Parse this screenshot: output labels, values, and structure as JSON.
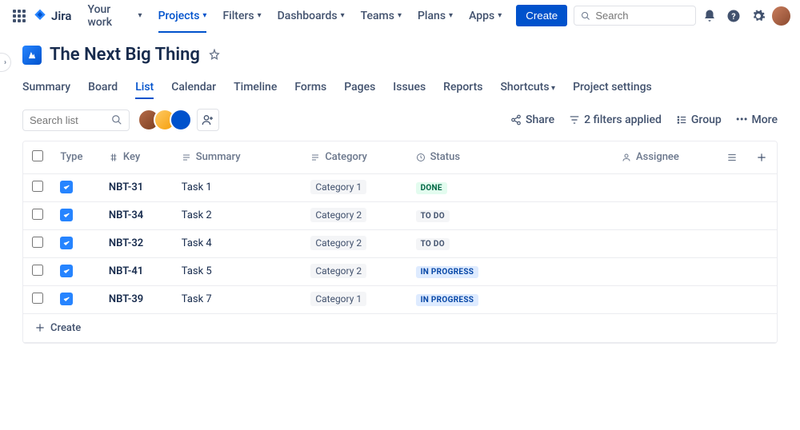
{
  "topnav": {
    "logo_text": "Jira",
    "items": [
      "Your work",
      "Projects",
      "Filters",
      "Dashboards",
      "Teams",
      "Plans",
      "Apps"
    ],
    "active_index": 1,
    "create_label": "Create",
    "search_placeholder": "Search"
  },
  "project": {
    "title": "The Next Big Thing"
  },
  "tabs": {
    "items": [
      "Summary",
      "Board",
      "List",
      "Calendar",
      "Timeline",
      "Forms",
      "Pages",
      "Issues",
      "Reports",
      "Shortcuts",
      "Project settings"
    ],
    "active_index": 2,
    "dropdown_indices": [
      9
    ]
  },
  "toolbar": {
    "search_placeholder": "Search list",
    "share_label": "Share",
    "filters_label": "2 filters applied",
    "group_label": "Group",
    "more_label": "More"
  },
  "table": {
    "columns": {
      "type": "Type",
      "key": "Key",
      "summary": "Summary",
      "category": "Category",
      "status": "Status",
      "assignee": "Assignee"
    },
    "rows": [
      {
        "key": "NBT-31",
        "summary": "Task 1",
        "category": "Category 1",
        "status": "DONE",
        "status_class": "status-done"
      },
      {
        "key": "NBT-34",
        "summary": "Task 2",
        "category": "Category 2",
        "status": "TO DO",
        "status_class": "status-todo"
      },
      {
        "key": "NBT-32",
        "summary": "Task 4",
        "category": "Category 2",
        "status": "TO DO",
        "status_class": "status-todo"
      },
      {
        "key": "NBT-41",
        "summary": "Task 5",
        "category": "Category 2",
        "status": "IN PROGRESS",
        "status_class": "status-inprogress"
      },
      {
        "key": "NBT-39",
        "summary": "Task 7",
        "category": "Category 1",
        "status": "IN PROGRESS",
        "status_class": "status-inprogress"
      }
    ],
    "create_label": "Create"
  }
}
